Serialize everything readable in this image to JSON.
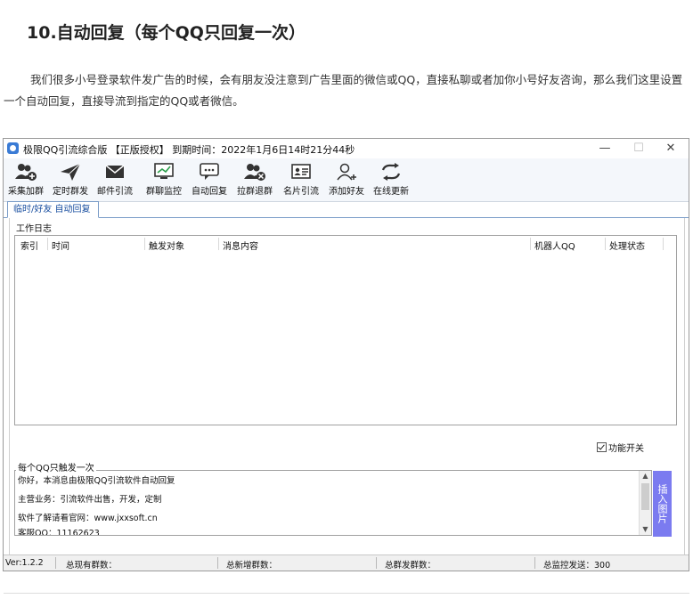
{
  "article": {
    "title": "10.自动回复（每个QQ只回复一次）",
    "paragraph": "我们很多小号登录软件发广告的时候，会有朋友没注意到广告里面的微信或QQ，直接私聊或者加你小号好友咨询，那么我们这里设置一个自动回复，直接导流到指定的QQ或者微信。"
  },
  "window": {
    "title": "极限QQ引流综合版 【正版授权】 到期时间：2022年1月6日14时21分44秒",
    "controls": [
      "—",
      "☐",
      "✕"
    ]
  },
  "toolbar": {
    "items": [
      {
        "label": "采集加群",
        "icon": "users-add-icon"
      },
      {
        "label": "定时群发",
        "icon": "send-icon"
      },
      {
        "label": "邮件引流",
        "icon": "mail-icon"
      },
      {
        "label": "群聊监控",
        "icon": "monitor-icon"
      },
      {
        "label": "自动回复",
        "icon": "chat-icon"
      },
      {
        "label": "拉群退群",
        "icon": "users-remove-icon"
      },
      {
        "label": "名片引流",
        "icon": "card-icon"
      },
      {
        "label": "添加好友",
        "icon": "user-add-icon"
      },
      {
        "label": "在线更新",
        "icon": "refresh-icon"
      }
    ]
  },
  "tab": {
    "label": "临时/好友 自动回复"
  },
  "log": {
    "group_label": "工作日志",
    "columns": [
      "索引",
      "时间",
      "触发对象",
      "消息内容",
      "机器人QQ",
      "处理状态"
    ]
  },
  "feature_switch": {
    "label": "功能开关",
    "checked": true
  },
  "reply": {
    "group_label": "每个QQ只触发一次",
    "lines": [
      "你好，本消息由极限QQ引流软件自动回复",
      "主营业务：引流软件出售，开发，定制",
      "软件了解请看官网：www.jxxsoft.cn",
      "客服QQ：11162623"
    ],
    "insert_button": "插入图片"
  },
  "status": {
    "version": "Ver:1.2.2",
    "total_groups": "总现有群数：",
    "new_groups": "总新增群数：",
    "sent_groups": "总群发群数：",
    "monitor_sent": "总监控发送：300"
  }
}
